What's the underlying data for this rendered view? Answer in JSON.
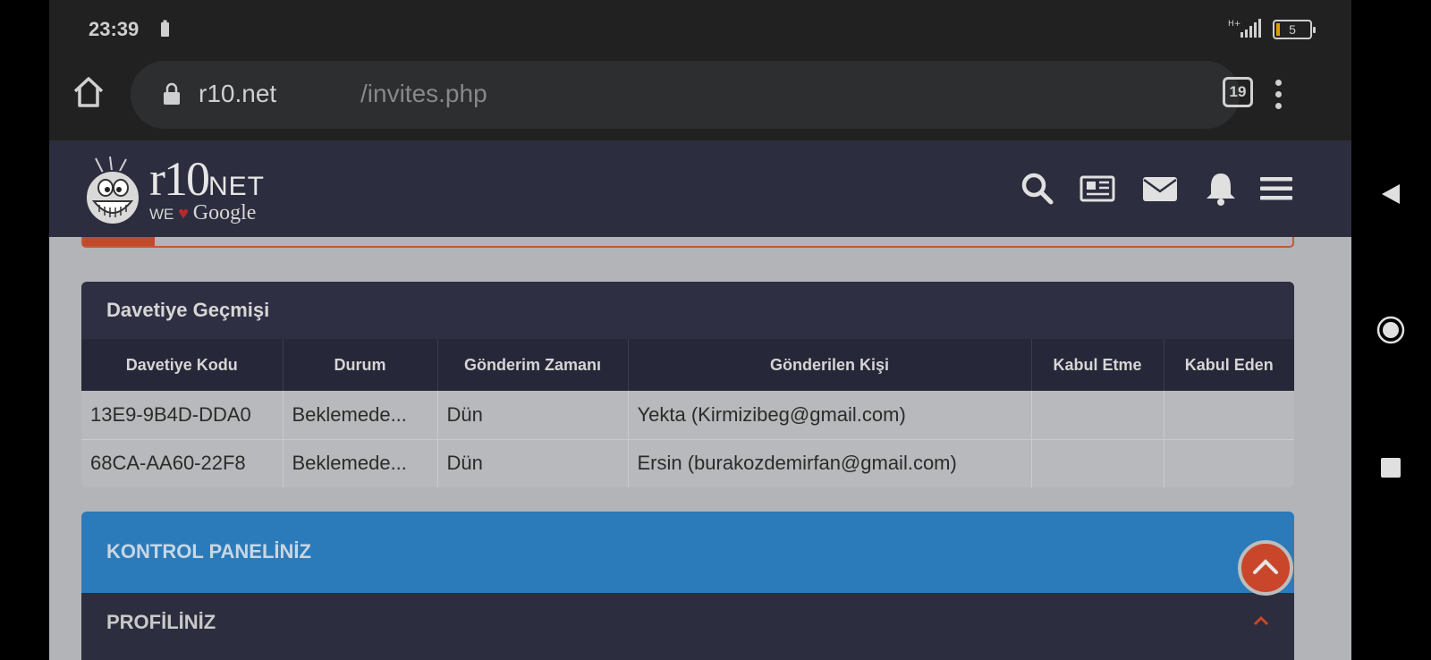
{
  "status_bar": {
    "time": "23:39",
    "network": "H+",
    "battery_level": "5"
  },
  "browser": {
    "url_domain": "r10.net",
    "url_path": "/invites.php",
    "tab_count": "19"
  },
  "site": {
    "logo_main": "r10",
    "logo_net": "NET",
    "logo_we": "WE",
    "logo_google": "Google"
  },
  "invite_history": {
    "title": "Davetiye Geçmişi",
    "columns": [
      "Davetiye Kodu",
      "Durum",
      "Gönderim Zamanı",
      "Gönderilen Kişi",
      "Kabul Etme",
      "Kabul Eden"
    ],
    "rows": [
      [
        "13E9-9B4D-DDA0",
        "Beklemede...",
        "Dün",
        "Yekta (Kirmizibeg@gmail.com)",
        "",
        ""
      ],
      [
        "68CA-AA60-22F8",
        "Beklemede...",
        "Dün",
        "Ersin (burakozdemirfan@gmail.com)",
        "",
        ""
      ]
    ]
  },
  "control_panel": {
    "title": "KONTROL PANELİNİZ",
    "profile_label": "PROFİLİNİZ"
  },
  "colors": {
    "accent_blue": "#2b7bba",
    "header_dark": "#2c2d3e",
    "scroll_button": "#c9462a"
  },
  "icons": [
    "home-icon",
    "lock-icon",
    "search-icon",
    "news-icon",
    "mail-icon",
    "bell-icon",
    "hamburger-icon",
    "chevron-up-icon",
    "back-icon",
    "home-circle-icon",
    "recents-icon"
  ]
}
